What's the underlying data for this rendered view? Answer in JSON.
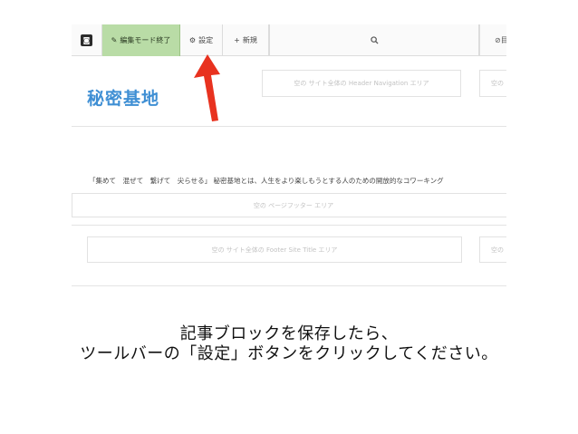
{
  "toolbar": {
    "logo_glyph": "◙",
    "edit_mode_label": "編集モード終了",
    "settings_label": "設定",
    "new_label": "新規",
    "search_icon": "search-icon",
    "right_label": "目"
  },
  "header": {
    "site_name": "秘密基地",
    "nav_area_1": "空の サイト全体の Header Navigation エリア",
    "nav_area_2": "空の"
  },
  "main": {
    "tagline": "「集めて　混ぜて　繋げて　尖らせる」 秘密基地とは、人生をより楽しもうとする人のための開放的なコワーキング"
  },
  "footer": {
    "page_footer_area": "空の ページフッター エリア",
    "site_title_area": "空の サイト全体の Footer Site Title エリア",
    "site_title_area_2": "空の"
  },
  "caption": {
    "line1": "記事ブロックを保存したら、",
    "line2": "ツールバーの「設定」ボタンをクリックしてください。"
  },
  "colors": {
    "edit_mode_bg": "#b9dca6",
    "site_name": "#3f8fd4",
    "arrow": "#e8321f"
  }
}
